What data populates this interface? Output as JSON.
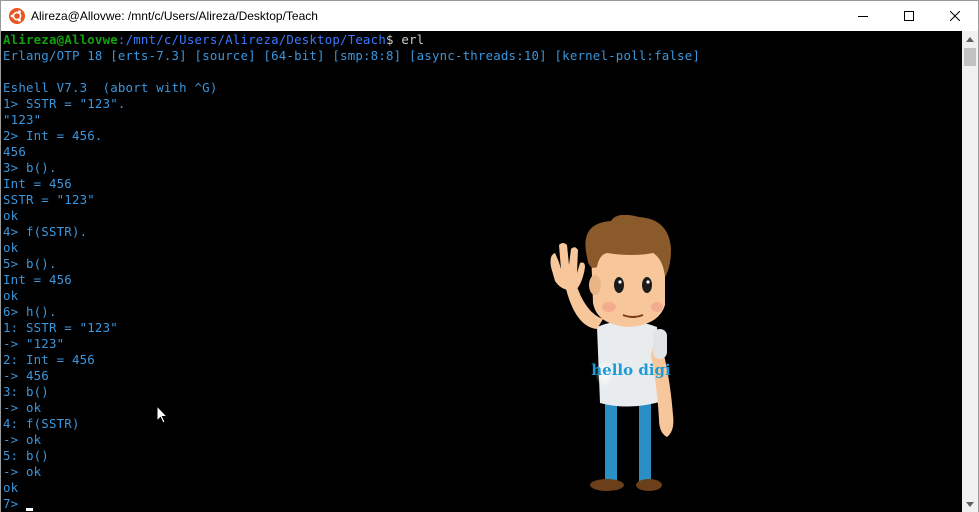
{
  "window": {
    "title": "Alireza@Allovwe: /mnt/c/Users/Alireza/Desktop/Teach",
    "controls": {
      "minimize": "minimize",
      "maximize": "maximize",
      "close": "close"
    }
  },
  "terminal": {
    "prompt_user": "Alireza@Allovwe",
    "prompt_path": ":/mnt/c/Users/Alireza/Desktop/Teach",
    "prompt_command": "$ erl",
    "lines": [
      "Erlang/OTP 18 [erts-7.3] [source] [64-bit] [smp:8:8] [async-threads:10] [kernel-poll:false]",
      "",
      "Eshell V7.3  (abort with ^G)",
      "1> SSTR = \"123\".",
      "\"123\"",
      "2> Int = 456.",
      "456",
      "3> b().",
      "Int = 456",
      "SSTR = \"123\"",
      "ok",
      "4> f(SSTR).",
      "ok",
      "5> b().",
      "Int = 456",
      "ok",
      "6> h().",
      "1: SSTR = \"123\"",
      "-> \"123\"",
      "2: Int = 456",
      "-> 456",
      "3: b()",
      "-> ok",
      "4: f(SSTR)",
      "-> ok",
      "5: b()",
      "-> ok",
      "ok",
      "7> "
    ]
  },
  "mascot": {
    "shirt_text": "hello digi"
  },
  "colors": {
    "terminal_bg": "#000000",
    "text": "#3a96dd",
    "prompt_user": "#13a10e",
    "prompt_path": "#3b78ff",
    "shirt_text": "#1e9bd7"
  }
}
